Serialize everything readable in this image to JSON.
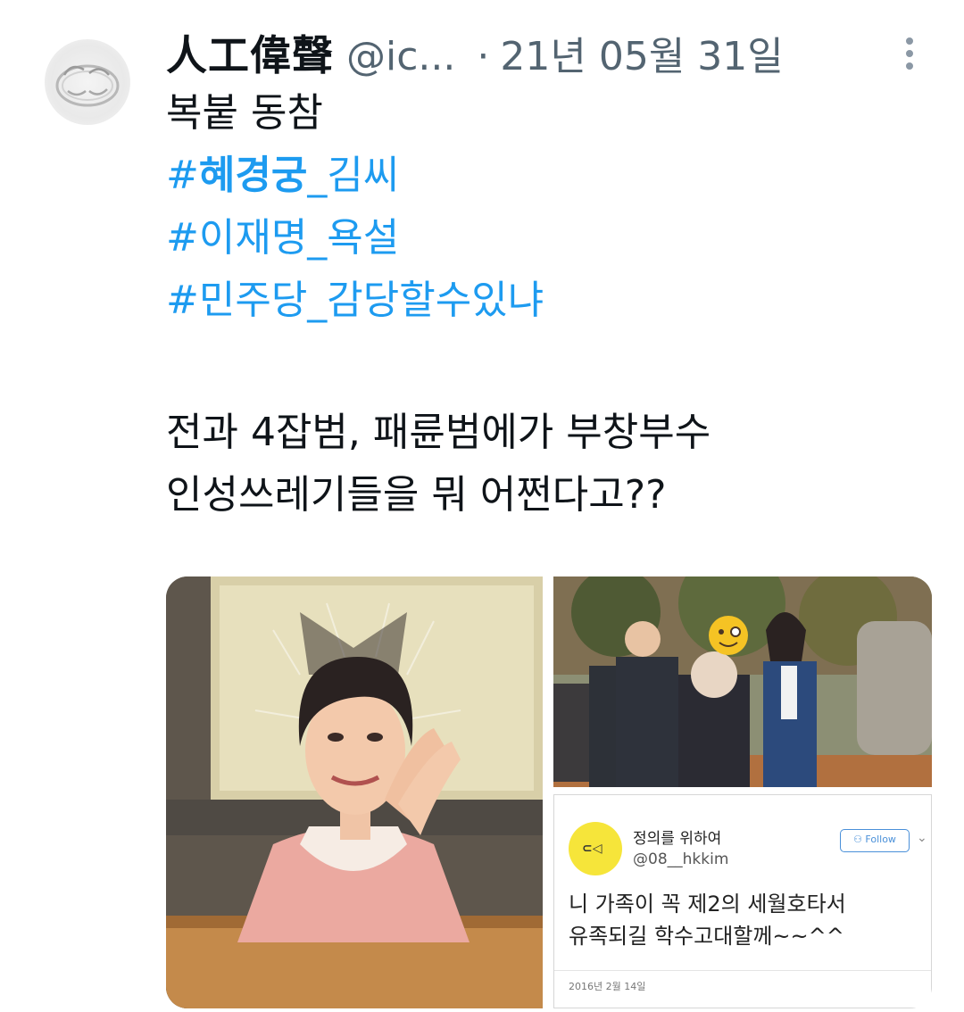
{
  "tweet": {
    "display_name": "人工偉聲",
    "handle": "@ic...",
    "separator": "·",
    "date": "21년 05월 31일",
    "lines": {
      "l1": "복붙 동참",
      "h1_hash": "#",
      "h1_bold": "혜경궁",
      "h1_rest": "_김씨",
      "h2": "#이재명_욕설",
      "h3": "#민주당_감당할수있냐",
      "l5": "전과 4잡범, 패륜범에가  부창부수",
      "l6": "인성쓰레기들을 뭐 어쩐다고??"
    }
  },
  "media": {
    "embedded_card": {
      "name": "정의를 위하여",
      "handle": "@08__hkkim",
      "follow_label": "Follow",
      "body_line1": "니 가족이 꼭 제2의 세월호타서",
      "body_line2": "유족되길 학수고대할께~~^^",
      "date": "2016년 2월 14일"
    }
  },
  "colors": {
    "hashtag": "#1d9bf0",
    "text": "#0f1419",
    "secondary": "#536471",
    "card_avatar": "#f6e53a"
  },
  "icons": [
    "more-vertical-icon",
    "ring-avatar-image"
  ]
}
